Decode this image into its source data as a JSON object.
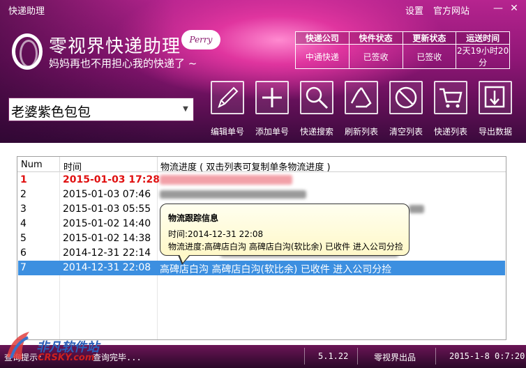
{
  "window": {
    "title": "快递助理",
    "settings": "设置",
    "official_site": "官方网站",
    "minimize": "—",
    "close": "✕"
  },
  "brand": {
    "title": "零视界快递助理",
    "subtitle": "妈妈再也不用担心我的快递了 ~",
    "badge": "Perry"
  },
  "status_table": {
    "headers": [
      "快递公司",
      "快件状态",
      "更新状态",
      "运送时间"
    ],
    "values": [
      "中通快递",
      "已签收",
      "已签收",
      "2天19小时20分"
    ]
  },
  "package_select": {
    "value": "老婆紫色包包"
  },
  "toolbar": [
    {
      "label": "编辑单号",
      "icon": "pencil-icon"
    },
    {
      "label": "添加单号",
      "icon": "plus-icon"
    },
    {
      "label": "快递搜索",
      "icon": "magnifier-icon"
    },
    {
      "label": "刷新列表",
      "icon": "recycle-icon"
    },
    {
      "label": "清空列表",
      "icon": "no-entry-icon"
    },
    {
      "label": "快递列表",
      "icon": "cart-icon"
    },
    {
      "label": "导出数据",
      "icon": "export-icon"
    }
  ],
  "list": {
    "columns": [
      "Num",
      "时间",
      "物流进度 ( 双击列表可复制单条物流进度 )"
    ],
    "rows": [
      {
        "num": "1",
        "time": "2015-01-03 17:28",
        "progress": ""
      },
      {
        "num": "2",
        "time": "2015-01-03 07:46",
        "progress": ""
      },
      {
        "num": "3",
        "time": "2015-01-03 05:55",
        "progress": ""
      },
      {
        "num": "4",
        "time": "2015-01-02 14:40",
        "progress": ""
      },
      {
        "num": "5",
        "time": "2015-01-02 14:38",
        "progress": ""
      },
      {
        "num": "6",
        "time": "2014-12-31 22:14",
        "progress": ""
      },
      {
        "num": "7",
        "time": "2014-12-31 22:08",
        "progress": "高碑店白沟 高碑店白沟(软比余) 已收件 进入公司分捡"
      }
    ]
  },
  "tooltip": {
    "title": "物流跟踪信息",
    "time_line": "时间:2014-12-31 22:08",
    "progress_line": "物流进度:高碑店白沟 高碑店白沟(软比余) 已收件 进入公司分捡"
  },
  "statusbar": {
    "hint": "查询提示:",
    "status": "查询完毕...",
    "version": "5.1.22",
    "producer": "零视界出品",
    "datetime": "2015-1-8 0:7:20"
  },
  "watermark": {
    "line1": "非凡软件站",
    "line2": "CRSKY.com"
  }
}
